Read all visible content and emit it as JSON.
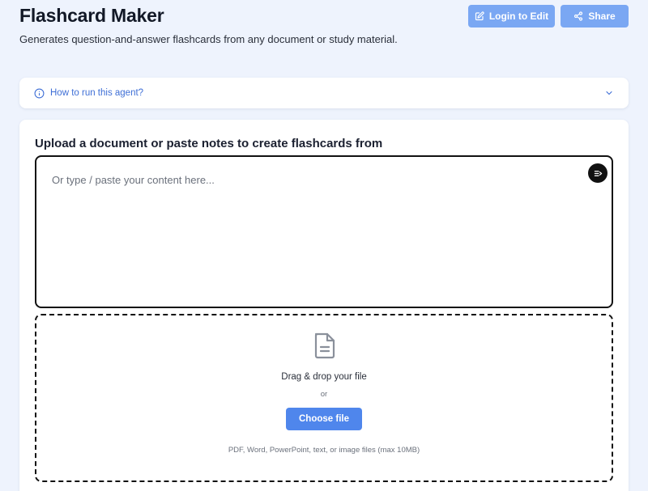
{
  "header": {
    "title": "Flashcard Maker",
    "subtitle": "Generates question-and-answer flashcards from any document or study material.",
    "login_label": "Login to Edit",
    "share_label": "Share"
  },
  "howto": {
    "label": "How to run this agent?"
  },
  "upload": {
    "title": "Upload a document or paste notes to create flashcards from",
    "placeholder": "Or type / paste your content here...",
    "value": "",
    "drop_title": "Drag & drop your file",
    "or_label": "or",
    "choose_label": "Choose file",
    "hint": "PDF, Word, PowerPoint, text, or image files (max 10MB)"
  },
  "colors": {
    "page_bg": "#eef3fd",
    "header_button": "#7aa7f3",
    "primary_button": "#4f86ec",
    "link": "#3f6fd6"
  },
  "icons": {
    "login": "edit-icon",
    "share": "share-icon",
    "howto": "info-icon",
    "expand": "chevron-down-icon",
    "submit": "send-icon",
    "file": "document-icon"
  }
}
